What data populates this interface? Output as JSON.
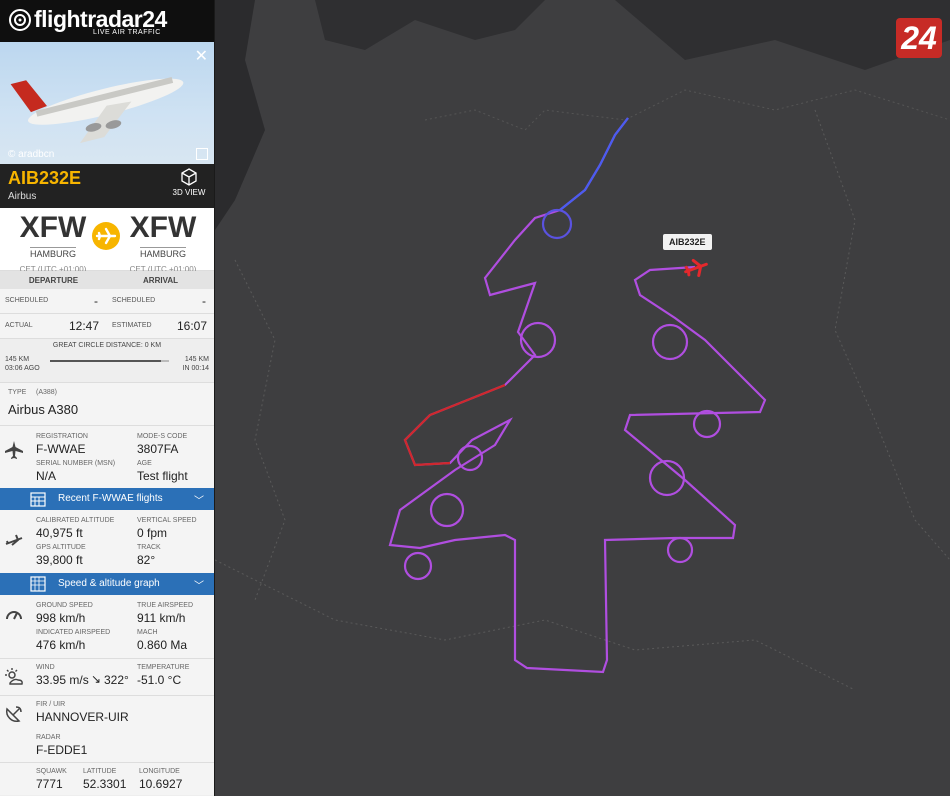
{
  "app": {
    "brand": "flightradar24",
    "tagline": "LIVE AIR TRAFFIC"
  },
  "photo": {
    "credit": "© aradbcn",
    "close_icon": "close-icon",
    "expand_icon": "expand-icon"
  },
  "flight": {
    "callsign": "AIB232E",
    "airline": "Airbus",
    "view3d_label": "3D VIEW"
  },
  "route": {
    "origin": {
      "code": "XFW",
      "city": "HAMBURG",
      "tz": "CET (UTC +01:00)"
    },
    "destination": {
      "code": "XFW",
      "city": "HAMBURG",
      "tz": "CET (UTC +01:00)"
    }
  },
  "times": {
    "departure_label": "DEPARTURE",
    "arrival_label": "ARRIVAL",
    "scheduled_label": "SCHEDULED",
    "scheduled_dep": "-",
    "scheduled_arr": "-",
    "actual_label": "ACTUAL",
    "actual_value": "12:47",
    "estimated_label": "ESTIMATED",
    "estimated_value": "16:07"
  },
  "distance": {
    "great_circle": "GREAT CIRCLE DISTANCE: 0 KM",
    "left_km": "145 KM",
    "left_ago": "03:06 AGO",
    "right_km": "145 KM",
    "right_in": "IN 00:14",
    "progress": 0.93
  },
  "aircraft": {
    "type_label": "TYPE",
    "type_code": "(A388)",
    "type_name": "Airbus A380"
  },
  "details": {
    "registration_label": "REGISTRATION",
    "registration": "F-WWAE",
    "modes_label": "MODE-S CODE",
    "modes": "3807FA",
    "serial_label": "SERIAL NUMBER (MSN)",
    "serial": "N/A",
    "age_label": "AGE",
    "age": "Test flight"
  },
  "recent_flights_label": "Recent F-WWAE flights",
  "altitude": {
    "cal_label": "CALIBRATED ALTITUDE",
    "cal": "40,975 ft",
    "vs_label": "VERTICAL SPEED",
    "vs": "0 fpm",
    "gps_label": "GPS ALTITUDE",
    "gps": "39,800 ft",
    "track_label": "TRACK",
    "track": "82°"
  },
  "graph_label": "Speed & altitude graph",
  "speed": {
    "gs_label": "GROUND SPEED",
    "gs": "998 km/h",
    "tas_label": "TRUE AIRSPEED",
    "tas": "911 km/h",
    "ias_label": "INDICATED AIRSPEED",
    "ias": "476 km/h",
    "mach_label": "MACH",
    "mach": "0.860 Ma"
  },
  "weather": {
    "wind_label": "WIND",
    "wind": "33.95 m/s",
    "wind_dir": "322°",
    "temp_label": "TEMPERATURE",
    "temp": "-51.0 °C"
  },
  "fir": {
    "label": "FIR / UIR",
    "value": "HANNOVER-UIR"
  },
  "radar": {
    "label": "RADAR",
    "value": "F-EDDE1"
  },
  "position": {
    "squawk_label": "SQUAWK",
    "squawk": "7771",
    "lat_label": "LATITUDE",
    "lat": "52.3301",
    "lon_label": "LONGITUDE",
    "lon": "10.6927"
  },
  "map": {
    "aircraft_label": "AIB232E",
    "watermark": "24",
    "track_color": "#b04ee0"
  }
}
